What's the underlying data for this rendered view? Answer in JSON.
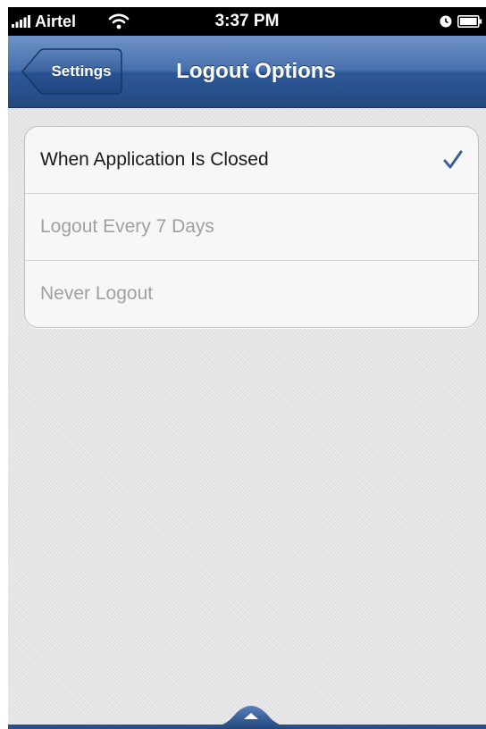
{
  "status_bar": {
    "carrier": "Airtel",
    "time": "3:37 PM",
    "icons": [
      "signal-bars-icon",
      "wifi-icon",
      "alarm-icon",
      "battery-icon"
    ]
  },
  "nav": {
    "back_label": "Settings",
    "title": "Logout Options"
  },
  "options": [
    {
      "label": "When Application Is Closed",
      "selected": true
    },
    {
      "label": "Logout Every 7 Days",
      "selected": false
    },
    {
      "label": "Never Logout",
      "selected": false
    }
  ],
  "footer": {
    "icon": "chevron-up-icon"
  },
  "colors": {
    "nav_bar": "#2d5797",
    "checkmark": "#3a5f99",
    "selected_text": "#1a1a1a",
    "unselected_text": "#a0a0a0"
  }
}
